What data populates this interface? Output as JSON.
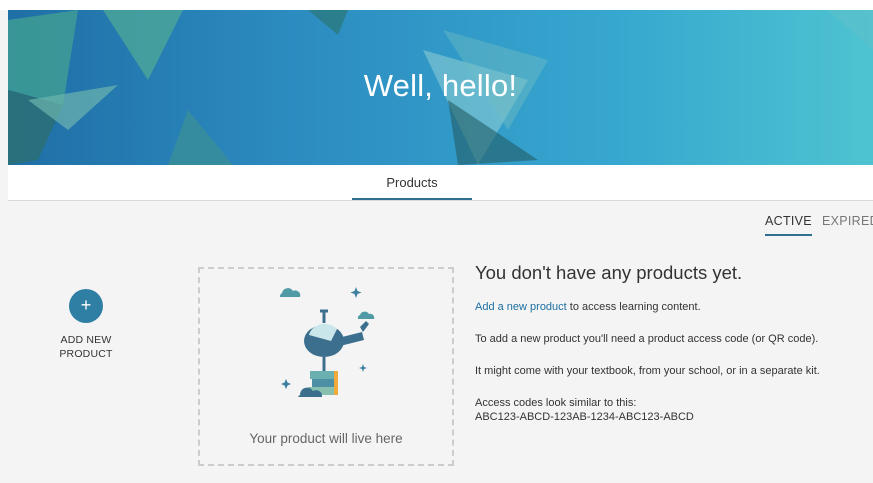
{
  "banner": {
    "title": "Well, hello!"
  },
  "tabs": {
    "products": "Products"
  },
  "filters": {
    "active": "ACTIVE",
    "expired": "EXPIRED"
  },
  "add_product": {
    "icon": "+",
    "label_line1": "ADD NEW",
    "label_line2": "PRODUCT"
  },
  "placeholder": {
    "text": "Your product will live here"
  },
  "empty_state": {
    "heading": "You don't have any products yet.",
    "link_text": "Add a new product",
    "link_suffix": " to access learning content.",
    "p2": "To add a new product you'll need a product access code (or QR code).",
    "p3": "It might come with your textbook, from your school, or in a separate kit.",
    "p4_line1": "Access codes look similar to this:",
    "p4_line2": "ABC123-ABCD-123AB-1234-ABC123-ABCD"
  },
  "colors": {
    "accent": "#2f7fa5",
    "link": "#1a6fa1",
    "banner": "#2d8dc1"
  }
}
